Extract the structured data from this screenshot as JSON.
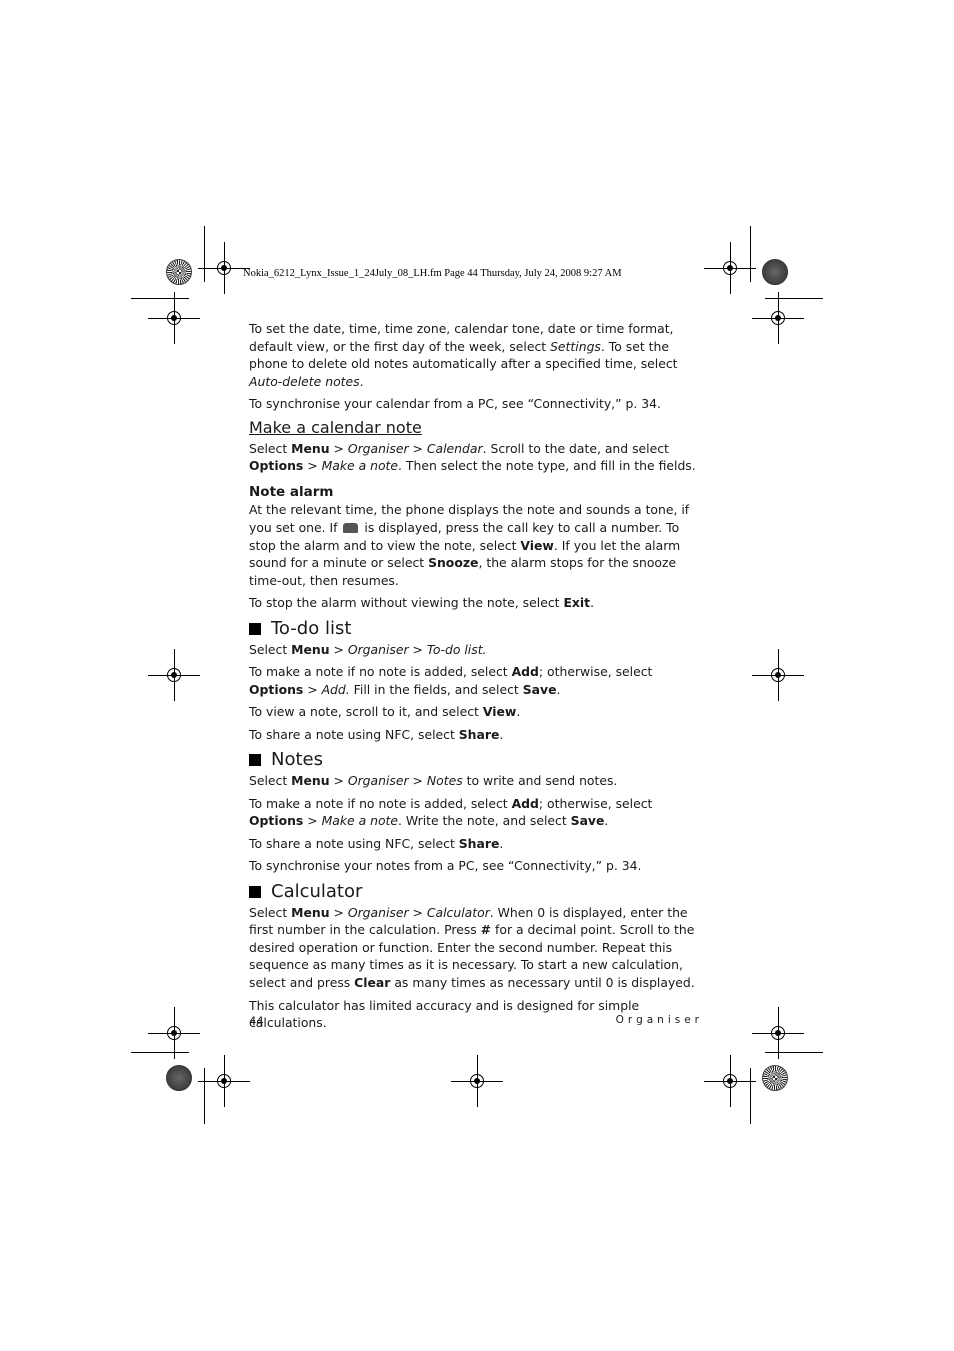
{
  "slug": "Nokia_6212_Lynx_Issue_1_24July_08_LH.fm  Page 44  Thursday, July 24, 2008  9:27 AM",
  "intro": {
    "p1": [
      {
        "t": "To set the date, time, time zone, calendar tone, date or time format, default view, or the first day of the week, select "
      },
      {
        "t": "Settings",
        "s": "i"
      },
      {
        "t": ". To set the phone to delete old notes automatically after a specified time, select "
      },
      {
        "t": "Auto-delete notes",
        "s": "i"
      },
      {
        "t": "."
      }
    ],
    "p2": [
      {
        "t": "To synchronise your calendar from a PC, see “Connectivity,” p. 34."
      }
    ]
  },
  "make_calendar_note": {
    "heading": "Make a calendar note",
    "p1": [
      {
        "t": "Select "
      },
      {
        "t": "Menu",
        "s": "b"
      },
      {
        "t": " > "
      },
      {
        "t": "Organiser",
        "s": "i"
      },
      {
        "t": " > "
      },
      {
        "t": "Calendar",
        "s": "i"
      },
      {
        "t": ". Scroll to the date, and select "
      },
      {
        "t": "Options",
        "s": "b"
      },
      {
        "t": " > "
      },
      {
        "t": "Make a note",
        "s": "i"
      },
      {
        "t": ". Then select the note type, and fill in the fields."
      }
    ]
  },
  "note_alarm": {
    "heading": "Note alarm",
    "p1a": [
      {
        "t": "At the relevant time, the phone displays the note and sounds a tone, if you set one. If "
      }
    ],
    "p1b": [
      {
        "t": " is displayed, press the call key to call a number. To stop the alarm and to view the note, select "
      },
      {
        "t": "View",
        "s": "b"
      },
      {
        "t": ". If you let the alarm sound for a minute or select "
      },
      {
        "t": "Snooze",
        "s": "b"
      },
      {
        "t": ", the alarm stops for the snooze time-out, then resumes."
      }
    ],
    "icon": "phone-call-icon",
    "p2": [
      {
        "t": "To stop the alarm without viewing the note, select "
      },
      {
        "t": "Exit",
        "s": "b"
      },
      {
        "t": "."
      }
    ]
  },
  "todo": {
    "heading": "To-do list",
    "p1": [
      {
        "t": "Select "
      },
      {
        "t": "Menu",
        "s": "b"
      },
      {
        "t": " > "
      },
      {
        "t": "Organiser",
        "s": "i"
      },
      {
        "t": " > "
      },
      {
        "t": "To-do list.",
        "s": "i"
      }
    ],
    "p2": [
      {
        "t": "To make a note if no note is added, select "
      },
      {
        "t": "Add",
        "s": "b"
      },
      {
        "t": "; otherwise, select "
      },
      {
        "t": "Options",
        "s": "b"
      },
      {
        "t": " > "
      },
      {
        "t": "Add.",
        "s": "i"
      },
      {
        "t": " Fill in the fields, and select "
      },
      {
        "t": "Save",
        "s": "b"
      },
      {
        "t": "."
      }
    ],
    "p3": [
      {
        "t": "To view a note, scroll to it, and select "
      },
      {
        "t": "View",
        "s": "b"
      },
      {
        "t": "."
      }
    ],
    "p4": [
      {
        "t": "To share a note using NFC, select "
      },
      {
        "t": "Share",
        "s": "b"
      },
      {
        "t": "."
      }
    ]
  },
  "notes": {
    "heading": "Notes",
    "p1": [
      {
        "t": "Select "
      },
      {
        "t": "Menu",
        "s": "b"
      },
      {
        "t": " > "
      },
      {
        "t": "Organiser",
        "s": "i"
      },
      {
        "t": " > "
      },
      {
        "t": "Notes",
        "s": "i"
      },
      {
        "t": " to write and send notes."
      }
    ],
    "p2": [
      {
        "t": "To make a note if no note is added, select "
      },
      {
        "t": "Add",
        "s": "b"
      },
      {
        "t": "; otherwise, select "
      },
      {
        "t": "Options",
        "s": "b"
      },
      {
        "t": " > "
      },
      {
        "t": "Make a note",
        "s": "i"
      },
      {
        "t": ". Write the note, and select "
      },
      {
        "t": "Save",
        "s": "b"
      },
      {
        "t": "."
      }
    ],
    "p3": [
      {
        "t": "To share a note using NFC, select "
      },
      {
        "t": "Share",
        "s": "b"
      },
      {
        "t": "."
      }
    ],
    "p4": [
      {
        "t": "To synchronise your notes from a PC, see “Connectivity,” p. 34."
      }
    ]
  },
  "calculator": {
    "heading": "Calculator",
    "p1": [
      {
        "t": "Select "
      },
      {
        "t": "Menu",
        "s": "b"
      },
      {
        "t": " > "
      },
      {
        "t": "Organiser",
        "s": "i"
      },
      {
        "t": " > "
      },
      {
        "t": "Calculator",
        "s": "i"
      },
      {
        "t": ". When 0 is displayed, enter the first number in the calculation. Press "
      },
      {
        "t": "#",
        "s": "b"
      },
      {
        "t": " for a decimal point. Scroll to the desired operation or function. Enter the second number. Repeat this sequence as many times as it is necessary. To start a new calculation, select and press "
      },
      {
        "t": "Clear",
        "s": "b"
      },
      {
        "t": " as many times as necessary until 0 is displayed."
      }
    ],
    "p2": [
      {
        "t": "This calculator has limited accuracy and is designed for simple calculations."
      }
    ]
  },
  "footer": {
    "page_number": "44",
    "section": "Organiser"
  }
}
